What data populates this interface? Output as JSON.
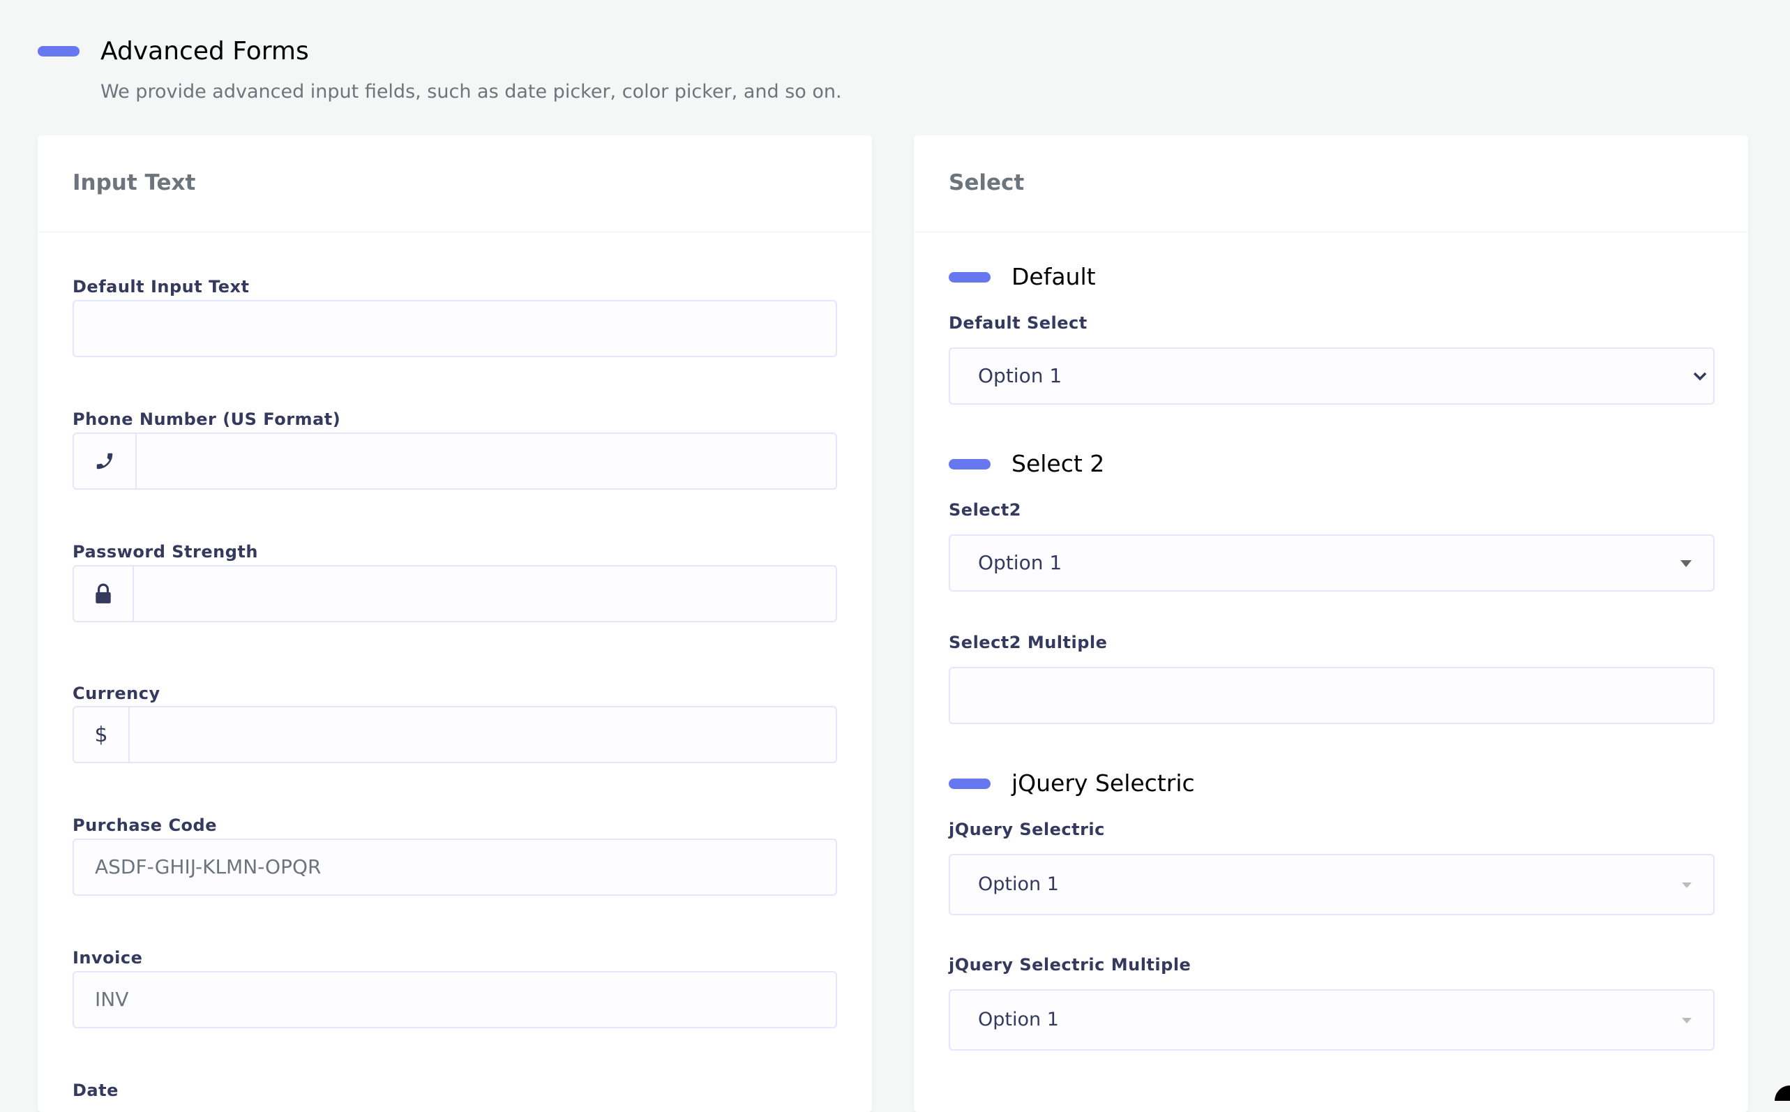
{
  "header": {
    "title": "Advanced Forms",
    "subtitle": "We provide advanced input fields, such as date picker, color picker, and so on."
  },
  "left_card": {
    "title": "Input Text",
    "fields": {
      "default_input": {
        "label": "Default Input Text",
        "value": ""
      },
      "phone": {
        "label": "Phone Number (US Format)",
        "value": "",
        "icon": "phone-icon"
      },
      "password": {
        "label": "Password Strength",
        "value": "",
        "icon": "lock-icon"
      },
      "currency": {
        "label": "Currency",
        "prefix": "$",
        "value": ""
      },
      "purchase_code": {
        "label": "Purchase Code",
        "placeholder": "ASDF-GHIJ-KLMN-OPQR"
      },
      "invoice": {
        "label": "Invoice",
        "value": "INV"
      },
      "date": {
        "label": "Date"
      }
    }
  },
  "right_card": {
    "title": "Select",
    "sections": {
      "default": {
        "title": "Default",
        "label": "Default Select",
        "value": "Option 1"
      },
      "select2": {
        "title": "Select 2",
        "label": "Select2",
        "value": "Option 1",
        "multiple_label": "Select2 Multiple",
        "multiple_value": ""
      },
      "selectric": {
        "title": "jQuery Selectric",
        "label": "jQuery Selectric",
        "value": "Option 1",
        "multiple_label": "jQuery Selectric Multiple",
        "multiple_value": "Option 1"
      }
    }
  },
  "colors": {
    "accent": "#6777ef",
    "label": "#34395e",
    "muted": "#6c757d",
    "border": "#e4e6fc"
  }
}
